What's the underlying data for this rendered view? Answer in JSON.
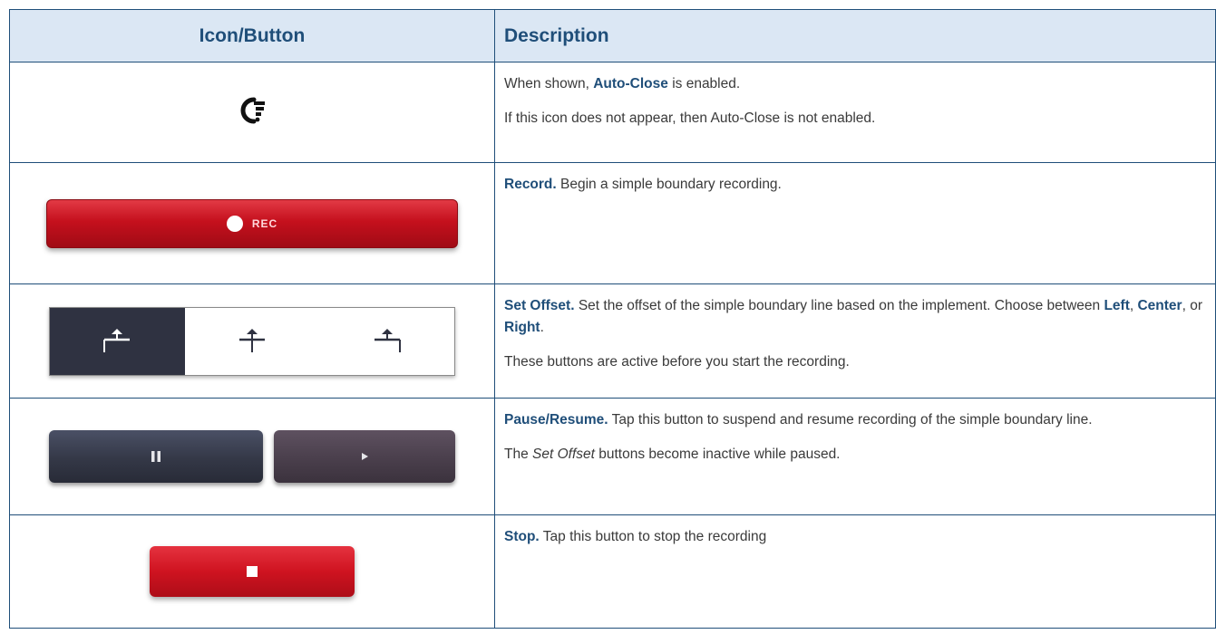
{
  "table": {
    "headers": [
      "Icon/Button",
      "Description"
    ],
    "rows": [
      {
        "icon": "auto-close-icon",
        "p1_pre": "When shown, ",
        "p1_bold": "Auto-Close",
        "p1_post": " is enabled.",
        "p2": "If this icon does not appear, then Auto-Close is not enabled."
      },
      {
        "icon": "record-button",
        "button_label": "REC",
        "bold": "Record.",
        "text": " Begin a simple boundary recording."
      },
      {
        "icon": "set-offset-buttons",
        "options": [
          "Left",
          "Center",
          "Right"
        ],
        "active_option": "Left",
        "bold": "Set Offset.",
        "text_pre": " Set the offset of the simple boundary line based on the implement. Choose between ",
        "sep1": ", ",
        "sep2": ", or ",
        "text_end": ".",
        "p2": "These buttons are active before you start the recording."
      },
      {
        "icon": "pause-resume-buttons",
        "bold": "Pause/Resume.",
        "text": " Tap this button to suspend and resume recording of the simple boundary line.",
        "p2_ital": "Set Offset",
        "p2_pre": "The ",
        "p2_post": " buttons become inactive while paused."
      },
      {
        "icon": "stop-button",
        "bold": "Stop.",
        "text": " Tap this button to stop the recording"
      }
    ]
  },
  "colors": {
    "header_bg": "#dbe7f4",
    "header_text": "#1f4e79",
    "border": "#1f4e79",
    "record_red": "#c5101d",
    "offset_active": "#2f3241"
  }
}
